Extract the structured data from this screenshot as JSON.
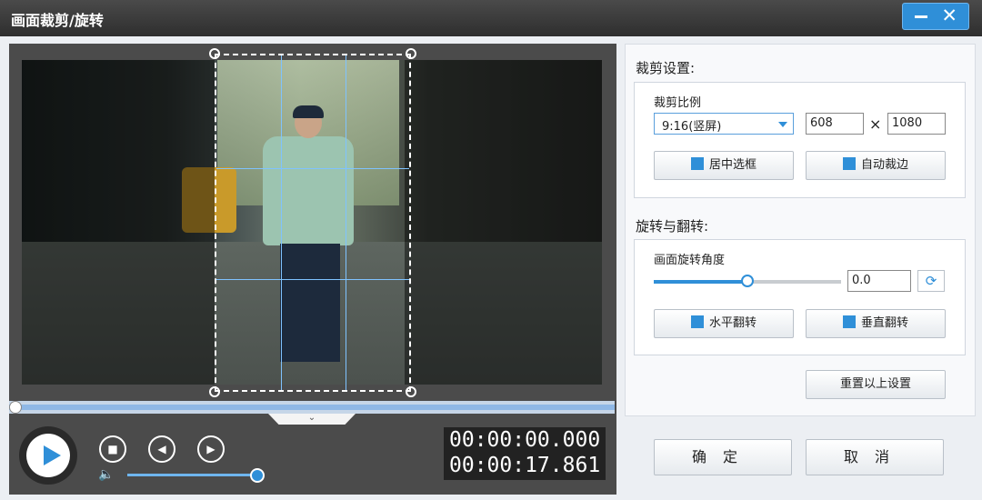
{
  "window": {
    "title": "画面裁剪/旋转",
    "minimize_label": "—",
    "close_label": "✕"
  },
  "crop_settings": {
    "section_title": "裁剪设置:",
    "ratio_label": "裁剪比例",
    "ratio_value": "9:16(竖屏)",
    "width": "608",
    "height": "1080",
    "times_symbol": "×",
    "center_button": "居中选框",
    "auto_trim_button": "自动裁边"
  },
  "rotate_settings": {
    "section_title": "旋转与翻转:",
    "angle_label": "画面旋转角度",
    "angle_value": "0.0",
    "slider_level": 0.5,
    "hflip_button": "水平翻转",
    "vflip_button": "垂直翻转"
  },
  "reset_button": "重置以上设置",
  "ok_button": "确定",
  "cancel_button": "取消",
  "player": {
    "current_time": "00:00:00.000",
    "total_time": "00:00:17.861",
    "progress": 0.0,
    "volume": 0.95,
    "collapse_glyph": "⌄",
    "stop_glyph": "■",
    "prev_glyph": "◀",
    "next_glyph": "▶",
    "volume_glyph": "🔈"
  },
  "icons": {
    "play": "play-icon",
    "rotate": "rotate-icon"
  },
  "colors": {
    "accent": "#2f8fd8",
    "titlebar": "#3a3a3a"
  }
}
